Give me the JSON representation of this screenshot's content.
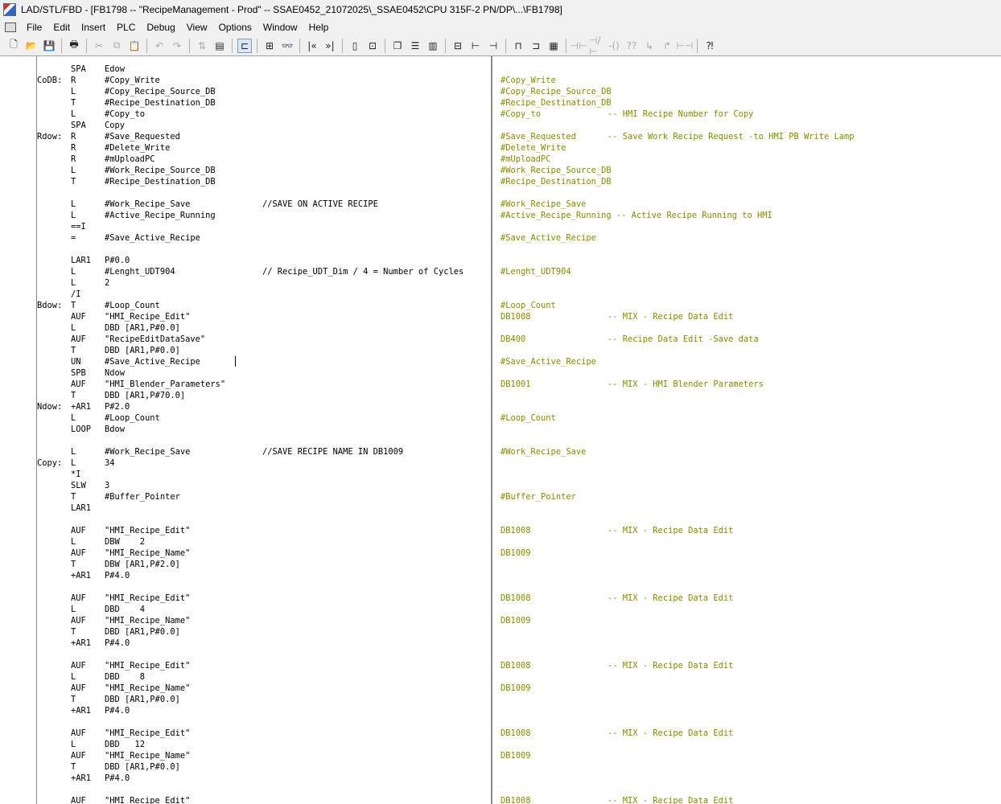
{
  "window": {
    "title": "LAD/STL/FBD  - [FB1798 -- \"RecipeManagement - Prod\" -- SSAE0452_21072025\\_SSAE0452\\CPU 315F-2 PN/DP\\...\\FB1798]"
  },
  "menu": [
    "File",
    "Edit",
    "Insert",
    "PLC",
    "Debug",
    "View",
    "Options",
    "Window",
    "Help"
  ],
  "toolbar": [
    {
      "icon": "new-icon",
      "glyph": "🗋"
    },
    {
      "icon": "open-icon",
      "glyph": "📂"
    },
    {
      "icon": "save-icon",
      "glyph": "💾"
    },
    {
      "sep": true
    },
    {
      "icon": "print-icon",
      "glyph": "🖶"
    },
    {
      "sep": true
    },
    {
      "icon": "cut-icon",
      "glyph": "✂",
      "disabled": true
    },
    {
      "icon": "copy-icon",
      "glyph": "⧉",
      "disabled": true
    },
    {
      "icon": "paste-icon",
      "glyph": "📋"
    },
    {
      "sep": true
    },
    {
      "icon": "undo-icon",
      "glyph": "↶",
      "disabled": true
    },
    {
      "icon": "redo-icon",
      "glyph": "↷",
      "disabled": true
    },
    {
      "sep": true
    },
    {
      "icon": "load-icon",
      "glyph": "⇅",
      "disabled": true
    },
    {
      "icon": "accessible-nodes-icon",
      "glyph": "▤"
    },
    {
      "sep": true
    },
    {
      "icon": "network-icon",
      "glyph": "⊏",
      "pressed": true
    },
    {
      "sep": true
    },
    {
      "icon": "overview-icon",
      "glyph": "⊞"
    },
    {
      "icon": "monitor-icon",
      "glyph": "👓"
    },
    {
      "sep": true
    },
    {
      "icon": "first-network-icon",
      "glyph": "|«"
    },
    {
      "icon": "last-network-icon",
      "glyph": "»|"
    },
    {
      "sep": true
    },
    {
      "icon": "lad-view-icon",
      "glyph": "▯"
    },
    {
      "icon": "details-icon",
      "glyph": "⊡"
    },
    {
      "sep": true
    },
    {
      "icon": "cascade-icon",
      "glyph": "❐"
    },
    {
      "icon": "tile-horizontal-icon",
      "glyph": "☰"
    },
    {
      "icon": "tile-vertical-icon",
      "glyph": "▥"
    },
    {
      "sep": true
    },
    {
      "icon": "insert-network-icon",
      "glyph": "⊟"
    },
    {
      "icon": "branch-open-icon",
      "glyph": "⊢"
    },
    {
      "icon": "branch-close-icon",
      "glyph": "⊣"
    },
    {
      "sep": true
    },
    {
      "icon": "box-icon",
      "glyph": "⊓"
    },
    {
      "icon": "coil-box-icon",
      "glyph": "⊐"
    },
    {
      "icon": "empty-box-icon",
      "glyph": "▦"
    },
    {
      "sep": true
    },
    {
      "icon": "no-contact-icon",
      "glyph": "⊣⊢",
      "disabled": true
    },
    {
      "icon": "nc-contact-icon",
      "glyph": "⊣/⊢",
      "disabled": true
    },
    {
      "icon": "coil-icon",
      "glyph": "-()",
      "disabled": true
    },
    {
      "icon": "empty-element-icon",
      "glyph": "??",
      "disabled": true
    },
    {
      "icon": "branch-down-icon",
      "glyph": "↳",
      "disabled": true
    },
    {
      "icon": "branch-up-icon",
      "glyph": "↱",
      "disabled": true
    },
    {
      "icon": "connection-icon",
      "glyph": "⊢⊣",
      "disabled": true
    },
    {
      "sep": true
    },
    {
      "icon": "help-icon",
      "glyph": "⁈"
    }
  ],
  "code": [
    {
      "label": "",
      "op": "SPA",
      "arg": "Edow",
      "comment": ""
    },
    {
      "label": "CoDB:",
      "op": "R",
      "arg": "#Copy_Write",
      "comment": ""
    },
    {
      "label": "",
      "op": "L",
      "arg": "#Copy_Recipe_Source_DB",
      "comment": ""
    },
    {
      "label": "",
      "op": "T",
      "arg": "#Recipe_Destination_DB",
      "comment": ""
    },
    {
      "label": "",
      "op": "L",
      "arg": "#Copy_to",
      "comment": ""
    },
    {
      "label": "",
      "op": "SPA",
      "arg": "Copy",
      "comment": ""
    },
    {
      "label": "Rdow:",
      "op": "R",
      "arg": "#Save_Requested",
      "comment": ""
    },
    {
      "label": "",
      "op": "R",
      "arg": "#Delete_Write",
      "comment": ""
    },
    {
      "label": "",
      "op": "R",
      "arg": "#mUploadPC",
      "comment": ""
    },
    {
      "label": "",
      "op": "L",
      "arg": "#Work_Recipe_Source_DB",
      "comment": ""
    },
    {
      "label": "",
      "op": "T",
      "arg": "#Recipe_Destination_DB",
      "comment": ""
    },
    {
      "label": "",
      "op": "",
      "arg": "",
      "comment": ""
    },
    {
      "label": "",
      "op": "L",
      "arg": "#Work_Recipe_Save",
      "comment": "//SAVE ON ACTIVE RECIPE"
    },
    {
      "label": "",
      "op": "L",
      "arg": "#Active_Recipe_Running",
      "comment": ""
    },
    {
      "label": "",
      "op": "==I",
      "arg": "",
      "comment": ""
    },
    {
      "label": "",
      "op": "=",
      "arg": "#Save_Active_Recipe",
      "comment": ""
    },
    {
      "label": "",
      "op": "",
      "arg": "",
      "comment": ""
    },
    {
      "label": "",
      "op": "LAR1",
      "arg": "P#0.0",
      "comment": ""
    },
    {
      "label": "",
      "op": "L",
      "arg": "#Lenght_UDT904",
      "comment": "// Recipe_UDT_Dim / 4 = Number of Cycles"
    },
    {
      "label": "",
      "op": "L",
      "arg": "2",
      "comment": ""
    },
    {
      "label": "",
      "op": "/I",
      "arg": "",
      "comment": ""
    },
    {
      "label": "Bdow:",
      "op": "T",
      "arg": "#Loop_Count",
      "comment": ""
    },
    {
      "label": "",
      "op": "AUF",
      "arg": "\"HMI_Recipe_Edit\"",
      "comment": ""
    },
    {
      "label": "",
      "op": "L",
      "arg": "DBD [AR1,P#0.0]",
      "comment": ""
    },
    {
      "label": "",
      "op": "AUF",
      "arg": "\"RecipeEditDataSave\"",
      "comment": ""
    },
    {
      "label": "",
      "op": "T",
      "arg": "DBD [AR1,P#0.0]",
      "comment": ""
    },
    {
      "label": "",
      "op": "UN",
      "arg": "#Save_Active_Recipe",
      "comment": ""
    },
    {
      "label": "",
      "op": "SPB",
      "arg": "Ndow",
      "comment": ""
    },
    {
      "label": "",
      "op": "AUF",
      "arg": "\"HMI_Blender_Parameters\"",
      "comment": ""
    },
    {
      "label": "",
      "op": "T",
      "arg": "DBD [AR1,P#70.0]",
      "comment": ""
    },
    {
      "label": "Ndow:",
      "op": "+AR1",
      "arg": "P#2.0",
      "comment": ""
    },
    {
      "label": "",
      "op": "L",
      "arg": "#Loop_Count",
      "comment": ""
    },
    {
      "label": "",
      "op": "LOOP",
      "arg": "Bdow",
      "comment": ""
    },
    {
      "label": "",
      "op": "",
      "arg": "",
      "comment": ""
    },
    {
      "label": "",
      "op": "L",
      "arg": "#Work_Recipe_Save",
      "comment": "//SAVE RECIPE NAME IN DB1009"
    },
    {
      "label": "Copy:",
      "op": "L",
      "arg": "34",
      "comment": ""
    },
    {
      "label": "",
      "op": "*I",
      "arg": "",
      "comment": ""
    },
    {
      "label": "",
      "op": "SLW",
      "arg": "3",
      "comment": ""
    },
    {
      "label": "",
      "op": "T",
      "arg": "#Buffer_Pointer",
      "comment": ""
    },
    {
      "label": "",
      "op": "LAR1",
      "arg": "",
      "comment": ""
    },
    {
      "label": "",
      "op": "",
      "arg": "",
      "comment": ""
    },
    {
      "label": "",
      "op": "AUF",
      "arg": "\"HMI_Recipe_Edit\"",
      "comment": ""
    },
    {
      "label": "",
      "op": "L",
      "arg": "DBW    2",
      "comment": ""
    },
    {
      "label": "",
      "op": "AUF",
      "arg": "\"HMI_Recipe_Name\"",
      "comment": ""
    },
    {
      "label": "",
      "op": "T",
      "arg": "DBW [AR1,P#2.0]",
      "comment": ""
    },
    {
      "label": "",
      "op": "+AR1",
      "arg": "P#4.0",
      "comment": ""
    },
    {
      "label": "",
      "op": "",
      "arg": "",
      "comment": ""
    },
    {
      "label": "",
      "op": "AUF",
      "arg": "\"HMI_Recipe_Edit\"",
      "comment": ""
    },
    {
      "label": "",
      "op": "L",
      "arg": "DBD    4",
      "comment": ""
    },
    {
      "label": "",
      "op": "AUF",
      "arg": "\"HMI_Recipe_Name\"",
      "comment": ""
    },
    {
      "label": "",
      "op": "T",
      "arg": "DBD [AR1,P#0.0]",
      "comment": ""
    },
    {
      "label": "",
      "op": "+AR1",
      "arg": "P#4.0",
      "comment": ""
    },
    {
      "label": "",
      "op": "",
      "arg": "",
      "comment": ""
    },
    {
      "label": "",
      "op": "AUF",
      "arg": "\"HMI_Recipe_Edit\"",
      "comment": ""
    },
    {
      "label": "",
      "op": "L",
      "arg": "DBD    8",
      "comment": ""
    },
    {
      "label": "",
      "op": "AUF",
      "arg": "\"HMI_Recipe_Name\"",
      "comment": ""
    },
    {
      "label": "",
      "op": "T",
      "arg": "DBD [AR1,P#0.0]",
      "comment": ""
    },
    {
      "label": "",
      "op": "+AR1",
      "arg": "P#4.0",
      "comment": ""
    },
    {
      "label": "",
      "op": "",
      "arg": "",
      "comment": ""
    },
    {
      "label": "",
      "op": "AUF",
      "arg": "\"HMI_Recipe_Edit\"",
      "comment": ""
    },
    {
      "label": "",
      "op": "L",
      "arg": "DBD   12",
      "comment": ""
    },
    {
      "label": "",
      "op": "AUF",
      "arg": "\"HMI_Recipe_Name\"",
      "comment": ""
    },
    {
      "label": "",
      "op": "T",
      "arg": "DBD [AR1,P#0.0]",
      "comment": ""
    },
    {
      "label": "",
      "op": "+AR1",
      "arg": "P#4.0",
      "comment": ""
    },
    {
      "label": "",
      "op": "",
      "arg": "",
      "comment": ""
    },
    {
      "label": "",
      "op": "AUF",
      "arg": "\"HMI_Recipe_Edit\"",
      "comment": ""
    }
  ],
  "symbols": [
    {
      "sym": "",
      "cmt": ""
    },
    {
      "sym": "#Copy_Write",
      "cmt": ""
    },
    {
      "sym": "#Copy_Recipe_Source_DB",
      "cmt": ""
    },
    {
      "sym": "#Recipe_Destination_DB",
      "cmt": ""
    },
    {
      "sym": "#Copy_to",
      "cmt": "-- HMI Recipe Number for Copy"
    },
    {
      "sym": "",
      "cmt": ""
    },
    {
      "sym": "#Save_Requested",
      "cmt": "-- Save Work Recipe Request -to HMI PB Write Lamp"
    },
    {
      "sym": "#Delete_Write",
      "cmt": ""
    },
    {
      "sym": "#mUploadPC",
      "cmt": ""
    },
    {
      "sym": "#Work_Recipe_Source_DB",
      "cmt": ""
    },
    {
      "sym": "#Recipe_Destination_DB",
      "cmt": ""
    },
    {
      "sym": "",
      "cmt": ""
    },
    {
      "sym": "#Work_Recipe_Save",
      "cmt": ""
    },
    {
      "sym": "#Active_Recipe_Running -- Active Recipe Running to HMI",
      "cmt": ""
    },
    {
      "sym": "",
      "cmt": ""
    },
    {
      "sym": "#Save_Active_Recipe",
      "cmt": ""
    },
    {
      "sym": "",
      "cmt": ""
    },
    {
      "sym": "",
      "cmt": ""
    },
    {
      "sym": "#Lenght_UDT904",
      "cmt": ""
    },
    {
      "sym": "",
      "cmt": ""
    },
    {
      "sym": "",
      "cmt": ""
    },
    {
      "sym": "#Loop_Count",
      "cmt": ""
    },
    {
      "sym": "DB1008",
      "cmt": "-- MIX - Recipe Data Edit"
    },
    {
      "sym": "",
      "cmt": ""
    },
    {
      "sym": "DB400",
      "cmt": "-- Recipe Data Edit -Save data"
    },
    {
      "sym": "",
      "cmt": ""
    },
    {
      "sym": "#Save_Active_Recipe",
      "cmt": ""
    },
    {
      "sym": "",
      "cmt": ""
    },
    {
      "sym": "DB1001",
      "cmt": "-- MIX - HMI Blender Parameters"
    },
    {
      "sym": "",
      "cmt": ""
    },
    {
      "sym": "",
      "cmt": ""
    },
    {
      "sym": "#Loop_Count",
      "cmt": ""
    },
    {
      "sym": "",
      "cmt": ""
    },
    {
      "sym": "",
      "cmt": ""
    },
    {
      "sym": "#Work_Recipe_Save",
      "cmt": ""
    },
    {
      "sym": "",
      "cmt": ""
    },
    {
      "sym": "",
      "cmt": ""
    },
    {
      "sym": "",
      "cmt": ""
    },
    {
      "sym": "#Buffer_Pointer",
      "cmt": ""
    },
    {
      "sym": "",
      "cmt": ""
    },
    {
      "sym": "",
      "cmt": ""
    },
    {
      "sym": "DB1008",
      "cmt": "-- MIX - Recipe Data Edit"
    },
    {
      "sym": "",
      "cmt": ""
    },
    {
      "sym": "DB1009",
      "cmt": ""
    },
    {
      "sym": "",
      "cmt": ""
    },
    {
      "sym": "",
      "cmt": ""
    },
    {
      "sym": "",
      "cmt": ""
    },
    {
      "sym": "DB1008",
      "cmt": "-- MIX - Recipe Data Edit"
    },
    {
      "sym": "",
      "cmt": ""
    },
    {
      "sym": "DB1009",
      "cmt": ""
    },
    {
      "sym": "",
      "cmt": ""
    },
    {
      "sym": "",
      "cmt": ""
    },
    {
      "sym": "",
      "cmt": ""
    },
    {
      "sym": "DB1008",
      "cmt": "-- MIX - Recipe Data Edit"
    },
    {
      "sym": "",
      "cmt": ""
    },
    {
      "sym": "DB1009",
      "cmt": ""
    },
    {
      "sym": "",
      "cmt": ""
    },
    {
      "sym": "",
      "cmt": ""
    },
    {
      "sym": "",
      "cmt": ""
    },
    {
      "sym": "DB1008",
      "cmt": "-- MIX - Recipe Data Edit"
    },
    {
      "sym": "",
      "cmt": ""
    },
    {
      "sym": "DB1009",
      "cmt": ""
    },
    {
      "sym": "",
      "cmt": ""
    },
    {
      "sym": "",
      "cmt": ""
    },
    {
      "sym": "",
      "cmt": ""
    },
    {
      "sym": "DB1008",
      "cmt": "-- MIX - Recipe Data Edit"
    }
  ],
  "colors": {
    "symbol_text": "#8a8a00",
    "code_text": "#000000",
    "splitter": "#8a8a8a"
  }
}
